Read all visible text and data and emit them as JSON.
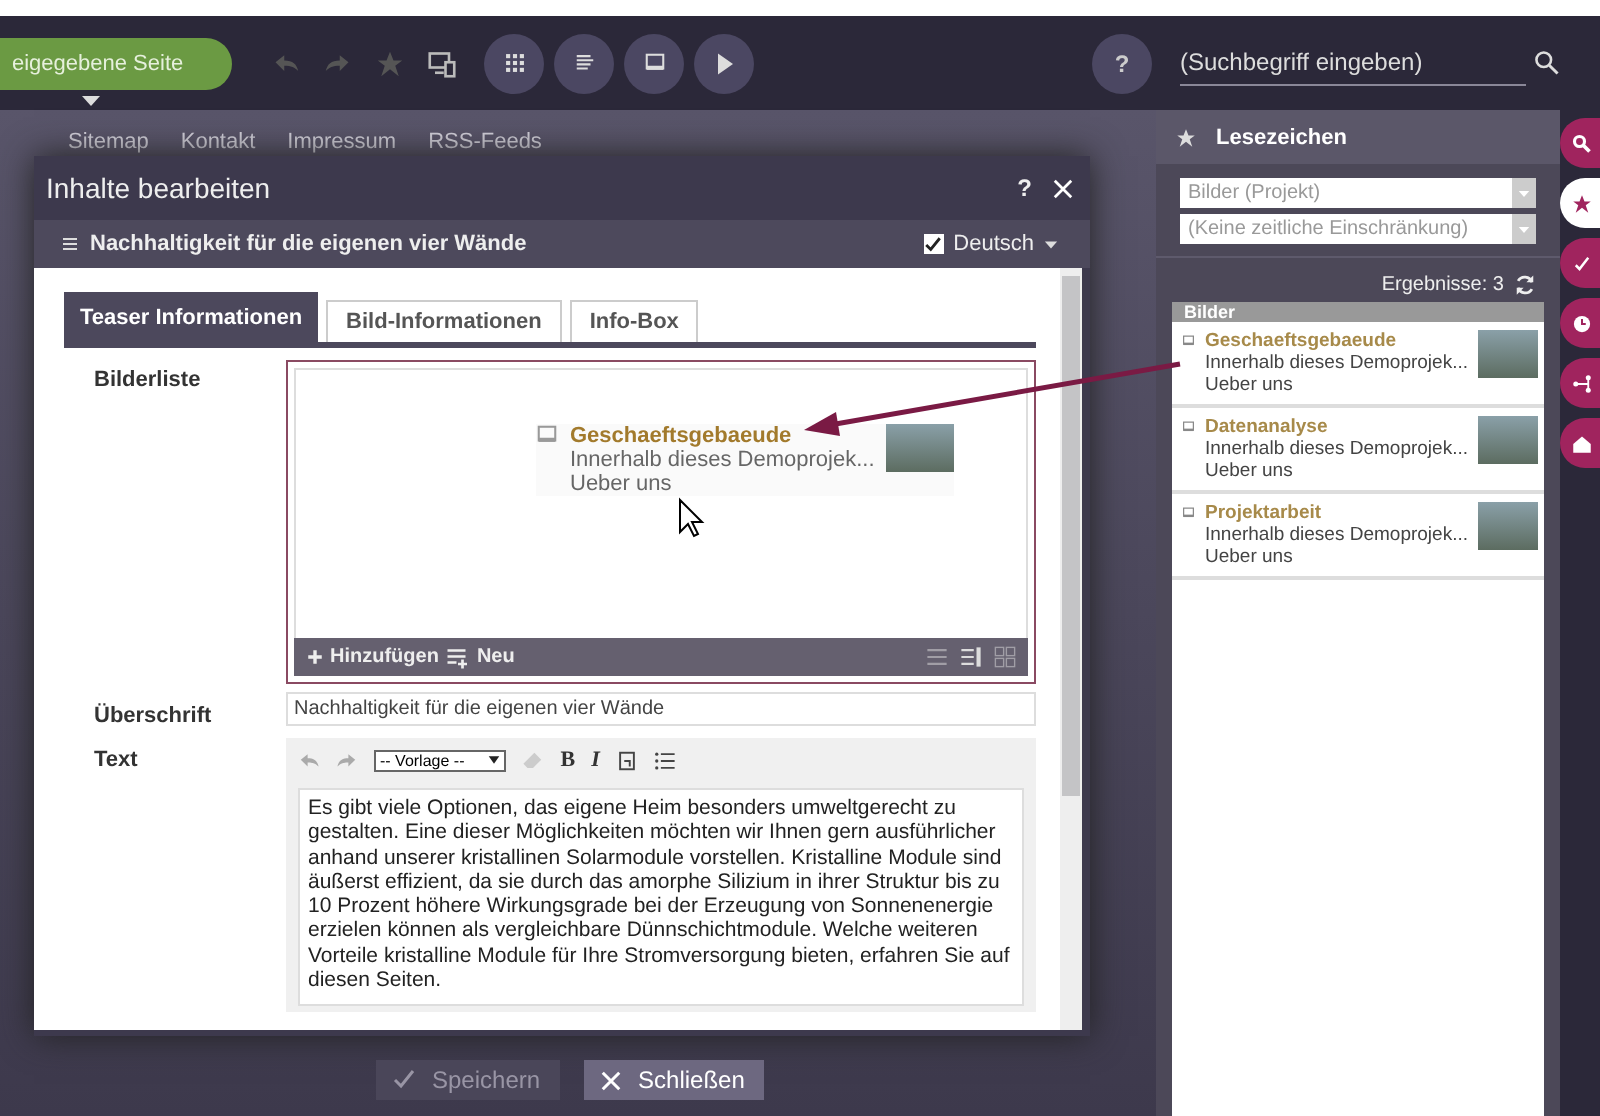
{
  "top_bar": {
    "page_button": "eigegebene Seite",
    "help": "?",
    "search": {
      "placeholder": "(Suchbegriff eingeben)"
    }
  },
  "page_links": [
    "Sitemap",
    "Kontakt",
    "Impressum",
    "RSS-Feeds"
  ],
  "dialog": {
    "title": "Inhalte bearbeiten",
    "help": "?",
    "content_title": "Nachhaltigkeit für die eigenen vier Wände",
    "language": {
      "label": "Deutsch",
      "checked": true
    },
    "tabs": [
      {
        "label": "Teaser Informationen",
        "selected": true
      },
      {
        "label": "Bild-Informationen",
        "selected": false
      },
      {
        "label": "Info-Box",
        "selected": false
      }
    ],
    "image_list": {
      "label": "Bilderliste",
      "dragged_item": {
        "title": "Geschaeftsgebaeude",
        "description": "Innerhalb dieses Demoprojek...",
        "path": "Ueber uns"
      },
      "add": "Hinzufügen",
      "new": "Neu",
      "views": [
        {
          "selected": false
        },
        {
          "selected": true
        },
        {
          "selected": false
        }
      ]
    },
    "heading": {
      "label": "Überschrift",
      "value": "Nachhaltigkeit für die eigenen vier Wände"
    },
    "text": {
      "label": "Text",
      "template": "-- Vorlage --",
      "bold": "B",
      "italic": "I",
      "body": "Es gibt viele Optionen, das eigene Heim besonders umweltgerecht zu gestalten. Eine dieser Möglichkeiten möchten wir Ihnen gern ausführlicher anhand unserer kristallinen Solarmodule vorstellen. Kristalline Module sind äußerst effizient, da sie durch das amorphe Silizium in ihrer Struktur bis zu 10 Prozent höhere Wirkungsgrade bei der Erzeugung von Sonnenenergie erzielen können als vergleichbare Dünnschichtmodule. Welche weiteren Vorteile kristalline Module für Ihre Stromversorgung bieten, erfahren Sie auf diesen Seiten."
    },
    "buttons": [
      {
        "label": "Speichern",
        "kind": "save",
        "disabled": true
      },
      {
        "label": "Schließen",
        "kind": "close",
        "disabled": false
      }
    ]
  },
  "bookmarks": {
    "title": "Lesezeichen",
    "filters": [
      "Bilder (Projekt)",
      "(Keine zeitliche Einschränkung)"
    ],
    "results": "Ergebnisse: 3",
    "group": "Bilder",
    "items": [
      {
        "title": "Geschaeftsgebaeude",
        "description": "Innerhalb dieses Demoprojek...",
        "path": "Ueber uns"
      },
      {
        "title": "Datenanalyse",
        "description": "Innerhalb dieses Demoprojek...",
        "path": "Ueber uns"
      },
      {
        "title": "Projektarbeit",
        "description": "Innerhalb dieses Demoprojek...",
        "path": "Ueber uns"
      }
    ]
  },
  "side_tools": [
    {
      "kind": "search",
      "selected": false
    },
    {
      "kind": "star",
      "selected": true
    },
    {
      "kind": "check",
      "selected": false
    },
    {
      "kind": "clock",
      "selected": false
    },
    {
      "kind": "share",
      "selected": false
    },
    {
      "kind": "home",
      "selected": false
    }
  ]
}
